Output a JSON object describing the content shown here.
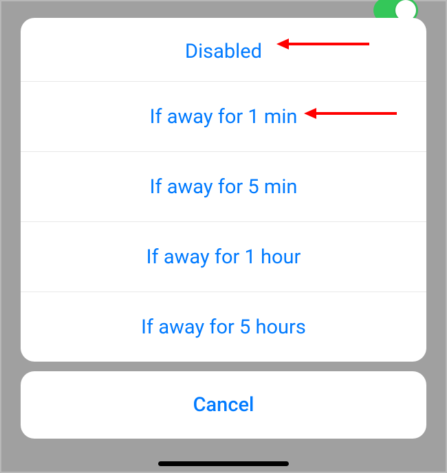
{
  "options": {
    "item0": "Disabled",
    "item1": "If away for 1 min",
    "item2": "If away for 5 min",
    "item3": "If away for 1 hour",
    "item4": "If away for 5 hours"
  },
  "cancel_label": "Cancel",
  "colors": {
    "accent": "#007aff",
    "toggle_on": "#34c759",
    "arrow": "#ff0000"
  }
}
